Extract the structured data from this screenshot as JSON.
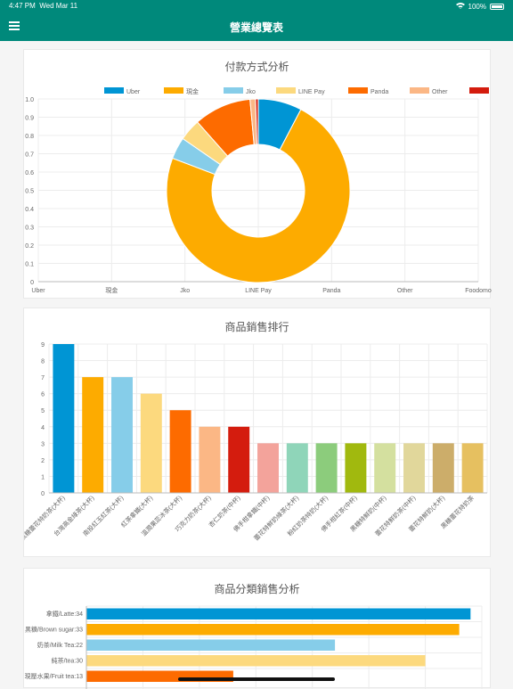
{
  "status_bar": {
    "time": "4:47 PM",
    "date": "Wed Mar 11",
    "battery": "100%"
  },
  "app_bar": {
    "title": "營業總覽表"
  },
  "colors": {
    "app_bar": "#00897b",
    "palette": [
      "#0095d4",
      "#fdab00",
      "#86cde9",
      "#fcd97e",
      "#fd6b00",
      "#fbb785",
      "#d41c0e",
      "#f3a39b",
      "#8fd5b9",
      "#8ccc7c",
      "#a1b90e",
      "#d4e09f",
      "#e1d79b",
      "#ccad6a",
      "#e6c060"
    ]
  },
  "chart_data": [
    {
      "type": "pie",
      "title": "付款方式分析",
      "categories": [
        "Uber",
        "現金",
        "Jko",
        "LINE Pay",
        "Panda",
        "Other",
        "Foodomo"
      ],
      "values": [
        0.08,
        0.76,
        0.04,
        0.04,
        0.105,
        0.01,
        0.005
      ],
      "ylim": [
        0,
        1.0
      ],
      "yticks": [
        "0",
        "0.1",
        "0.2",
        "0.3",
        "0.4",
        "0.5",
        "0.6",
        "0.7",
        "0.8",
        "0.9",
        "1.0"
      ],
      "legend_position": "top",
      "grid": true
    },
    {
      "type": "bar",
      "title": "商品銷售排行",
      "categories": [
        "黑糖蕾花特奶茶(大杯)",
        "台灣高金綠茶(大杯)",
        "南投紅玉紅茶(大杯)",
        "紅茶拿鐵(大杯)",
        "溫潤果蕊冰茶(大杯)",
        "巧克力奶茶(大杯)",
        "杏仁奶茶(中杯)",
        "佛手柑拿鐵(中杯)",
        "蕾花特鮮奶綠茶(大杯)",
        "粉紅奶茶特奶(大杯)",
        "佛手柑紅茶(中杯)",
        "黑糖特鮮奶(中杯)",
        "蕾花特鮮奶茶(中杯)",
        "蕾花特鮮奶(大杯)",
        "黑糖蕾花特奶茶"
      ],
      "values": [
        9,
        7,
        7,
        6,
        5,
        4,
        4,
        3,
        3,
        3,
        3,
        3,
        3,
        3,
        3
      ],
      "ylim": [
        0,
        9
      ],
      "yticks": [
        "0",
        "1",
        "2",
        "3",
        "4",
        "5",
        "6",
        "7",
        "8",
        "9"
      ],
      "grid": true
    },
    {
      "type": "bar",
      "orientation": "horizontal",
      "title": "商品分類銷售分析",
      "categories": [
        "拿鐵/Latte:34",
        "黑糖/Brown sugar:33",
        "奶茶/Milk Tea:22",
        "純茶/tea:30",
        "現壓水果/Fruit tea:13"
      ],
      "values": [
        34,
        33,
        22,
        30,
        13
      ],
      "xlim": [
        0,
        35
      ],
      "grid": true
    }
  ]
}
